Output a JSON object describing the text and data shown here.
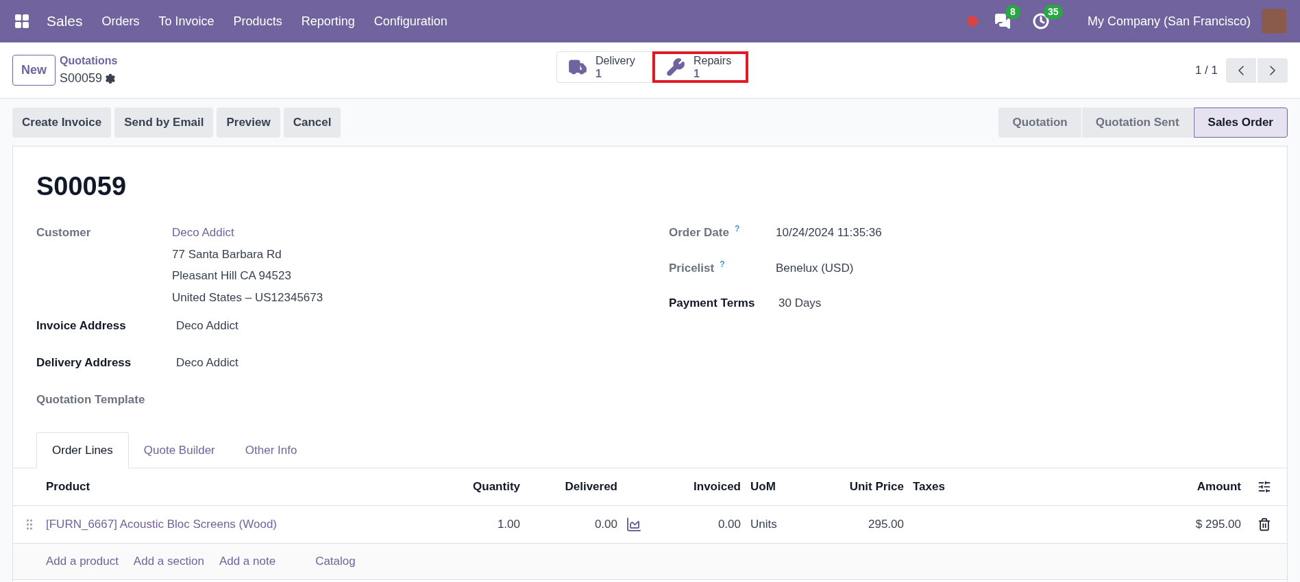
{
  "navbar": {
    "app": "Sales",
    "menu": [
      "Orders",
      "To Invoice",
      "Products",
      "Reporting",
      "Configuration"
    ],
    "messages_count": "8",
    "activities_count": "35",
    "company": "My Company (San Francisco)"
  },
  "control_panel": {
    "new_button": "New",
    "breadcrumb": "Quotations",
    "record": "S00059",
    "smart_buttons": [
      {
        "kind": "truck",
        "label": "Delivery",
        "value": "1",
        "highlighted": false
      },
      {
        "kind": "wrench",
        "label": "Repairs",
        "value": "1",
        "highlighted": true
      }
    ],
    "pager": "1 / 1"
  },
  "actions": [
    "Create Invoice",
    "Send by Email",
    "Preview",
    "Cancel"
  ],
  "statuses": [
    {
      "label": "Quotation",
      "selected": false
    },
    {
      "label": "Quotation Sent",
      "selected": false
    },
    {
      "label": "Sales Order",
      "selected": true
    }
  ],
  "form": {
    "title": "S00059",
    "left_fields": [
      {
        "label": "Customer",
        "bold": false,
        "link": "Deco Addict",
        "lines": [
          "77 Santa Barbara Rd",
          "Pleasant Hill CA 94523",
          "United States – US12345673"
        ]
      },
      {
        "label": "Invoice Address",
        "bold": true,
        "value": "Deco Addict"
      },
      {
        "label": "Delivery Address",
        "bold": true,
        "value": "Deco Addict"
      },
      {
        "label": "Quotation Template",
        "bold": false
      }
    ],
    "right_fields": [
      {
        "label": "Order Date",
        "help": "?",
        "bold": false,
        "value": "10/24/2024 11:35:36"
      },
      {
        "label": "Pricelist",
        "help": "?",
        "bold": false,
        "value": "Benelux (USD)"
      },
      {
        "label": "Payment Terms",
        "bold": true,
        "value": "30 Days"
      }
    ]
  },
  "tabs": [
    {
      "label": "Order Lines",
      "selected": true
    },
    {
      "label": "Quote Builder",
      "selected": false
    },
    {
      "label": "Other Info",
      "selected": false
    }
  ],
  "table": {
    "columns": [
      "Product",
      "Quantity",
      "Delivered",
      "Invoiced",
      "UoM",
      "Unit Price",
      "Taxes",
      "Amount"
    ],
    "rows": [
      {
        "product": "[FURN_6667] Acoustic Bloc Screens (Wood)",
        "quantity": "1.00",
        "delivered": "0.00",
        "invoiced": "0.00",
        "uom": "Units",
        "unit_price": "295.00",
        "amount": "$ 295.00"
      }
    ],
    "add_links": [
      "Add a product",
      "Add a section",
      "Add a note",
      "Catalog"
    ]
  }
}
